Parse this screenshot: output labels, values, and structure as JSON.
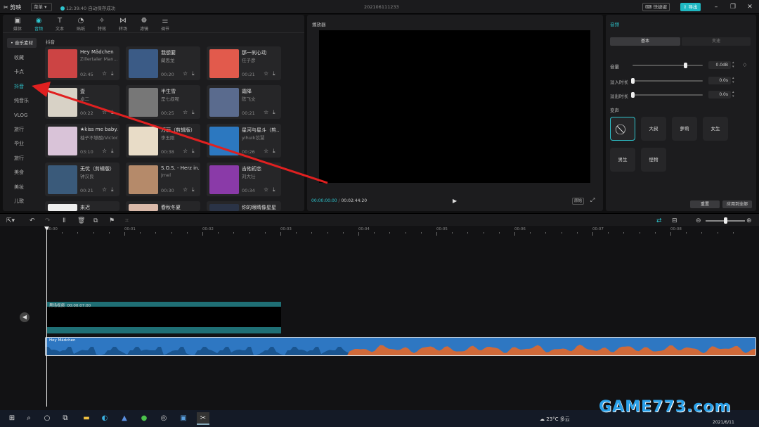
{
  "titlebar": {
    "app_name": "剪映",
    "menu_label": "菜单",
    "save_status": "12:39:40 自动保存成功",
    "project_name": "202106111233",
    "shortcut_label": "快捷键",
    "export_label": "导出"
  },
  "toolbar": [
    {
      "label": "媒体",
      "icon": "media-icon"
    },
    {
      "label": "音频",
      "icon": "audio-icon",
      "active": true
    },
    {
      "label": "文本",
      "icon": "text-icon"
    },
    {
      "label": "贴纸",
      "icon": "sticker-icon"
    },
    {
      "label": "特效",
      "icon": "effects-icon"
    },
    {
      "label": "转场",
      "icon": "transition-icon"
    },
    {
      "label": "滤镜",
      "icon": "filter-icon"
    },
    {
      "label": "调节",
      "icon": "adjust-icon"
    }
  ],
  "categories": {
    "header": "• 音乐素材",
    "items": [
      "收藏",
      "卡点",
      "抖音",
      "纯音乐",
      "VLOG",
      "旅行",
      "毕业",
      "旅行",
      "美食",
      "美妆",
      "儿歌"
    ],
    "active_index": 2
  },
  "library": {
    "section_title": "抖音",
    "cards": [
      {
        "title": "Hey Mädchen",
        "artist": "Zillertaler Man...",
        "duration": "02:45",
        "color": "#c44"
      },
      {
        "title": "我想要",
        "artist": "藏思龙",
        "duration": "00:20",
        "color": "#3b5b86"
      },
      {
        "title": "那一刹心动",
        "artist": "任子彦",
        "duration": "00:21",
        "color": "#e25a4c"
      },
      {
        "title": "壹",
        "artist": "卓二",
        "duration": "00:22",
        "color": "#d8d2c6"
      },
      {
        "title": "半生雪",
        "artist": "是七叔呢",
        "duration": "00:25",
        "color": "#777"
      },
      {
        "title": "霜降",
        "artist": "陈飞文",
        "duration": "00:21",
        "color": "#5a6b8e"
      },
      {
        "title": "★kiss me baby...",
        "artist": "柚子不够酸/Victor...",
        "duration": "03:10",
        "color": "#d9c3d8"
      },
      {
        "title": "万丽（剪辑版）",
        "artist": "李玉刚",
        "duration": "00:38",
        "color": "#e8dcc7"
      },
      {
        "title": "星河与星斗（剪...",
        "artist": "yihuik苡慧",
        "duration": "00:26",
        "color": "#2c78c0"
      },
      {
        "title": "无忧（剪辑版）",
        "artist": "钟汉良",
        "duration": "00:21",
        "color": "#3a5a7a"
      },
      {
        "title": "S.O.S. - Herz in...",
        "artist": "Jmel",
        "duration": "00:30",
        "color": "#b58a6a"
      },
      {
        "title": "吉他初恋",
        "artist": "刘大壮",
        "duration": "00:34",
        "color": "#8a3aa8"
      },
      {
        "title": "来迟",
        "artist": "",
        "duration": "",
        "color": "#eee"
      },
      {
        "title": "春秋冬夏",
        "artist": "",
        "duration": "",
        "color": "#d9b9a9"
      },
      {
        "title": "你的眼睛像星星",
        "artist": "",
        "duration": "",
        "color": "#2a3346"
      }
    ]
  },
  "player": {
    "title": "播放器",
    "current_time": "00:00:00:00",
    "total_time": "00:02:44:20",
    "ratio_label": "原始"
  },
  "audio_panel": {
    "title": "音频",
    "tabs": [
      "基本",
      "变速"
    ],
    "volume": {
      "label": "音量",
      "value": "0.0dB",
      "level": 0.75
    },
    "fade_in": {
      "label": "淡入时长",
      "value": "0.0s",
      "level": 0.0
    },
    "fade_out": {
      "label": "淡出时长",
      "value": "0.0s",
      "level": 0.0
    },
    "voice_change_label": "变声",
    "voice_options": [
      "无",
      "大叔",
      "萝莉",
      "女生",
      "男生",
      "怪物"
    ],
    "reset_label": "重置",
    "apply_all_label": "应用到全部"
  },
  "timeline": {
    "ruler": [
      "00:00",
      "00:01",
      "00:02",
      "00:03",
      "00:04",
      "00:05",
      "00:06",
      "00:07",
      "00:08"
    ],
    "black_clip": {
      "label": "黑场视频",
      "duration": "00:00:07:00"
    },
    "audio_clip": {
      "label": "Hey Mädchen"
    }
  },
  "taskbar": {
    "weather": "23°C 多云",
    "date": "2021/6/11"
  },
  "watermark": "GAME773.com",
  "colors": {
    "accent": "#2ec5ce",
    "arrow": "#e02020",
    "audio_clip": "#2e77c2",
    "video_clip": "#1f6f75"
  }
}
